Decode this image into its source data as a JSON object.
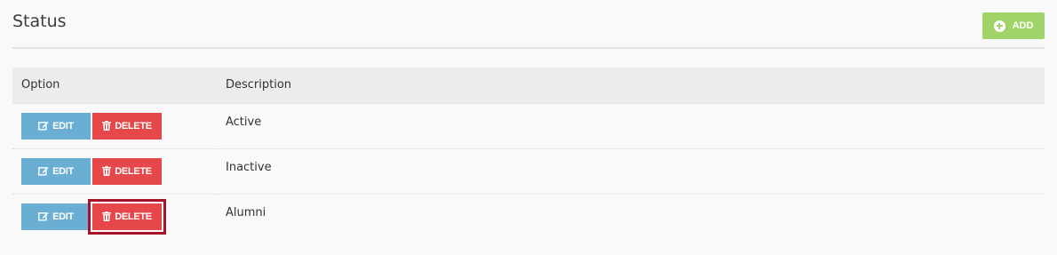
{
  "header": {
    "title": "Status",
    "add_label": "ADD"
  },
  "table": {
    "columns": [
      "Option",
      "Description"
    ],
    "edit_label": "EDIT",
    "delete_label": "DELETE",
    "rows": [
      {
        "description": "Active"
      },
      {
        "description": "Inactive"
      },
      {
        "description": "Alumni"
      }
    ]
  },
  "icons": {
    "add": "plus-circle-icon",
    "edit": "edit-icon",
    "delete": "trash-icon"
  },
  "colors": {
    "add_button": "#a0d468",
    "edit_button": "#6aafd3",
    "delete_button": "#e6474a",
    "highlight": "#a8132a"
  }
}
